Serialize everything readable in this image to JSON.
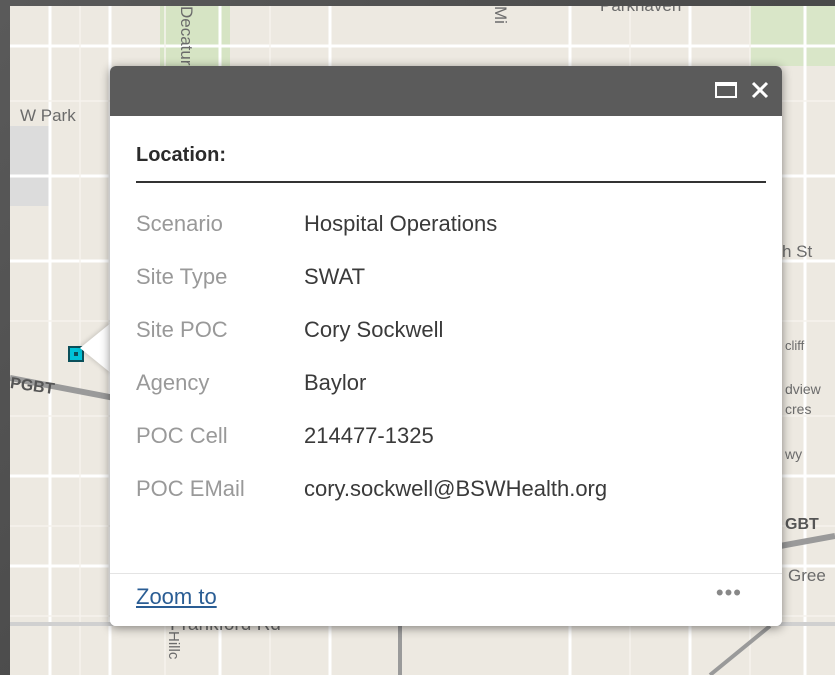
{
  "map": {
    "labels": {
      "top_left_street": "W Park",
      "top_center_partial": "Parkhaven",
      "right_street": "h St",
      "right_partial_1": "cliff",
      "right_partial_2": "dview",
      "right_partial_3": "cres",
      "right_partial_4": "wy",
      "right_road": "GBT",
      "right_partial_5": "Gree",
      "bottom_street": "Frankford Rd",
      "left_road": "PGBT",
      "left_bottom": "Rd",
      "vertical_top": "Decatur",
      "vertical_top2": "Mi",
      "bottom_vertical": "Hillc"
    }
  },
  "marker": {
    "color": "#00c3d8"
  },
  "popup": {
    "title": "Location:",
    "maximize_icon": "maximize-icon",
    "close_icon": "close-icon",
    "attributes": [
      {
        "name": "Scenario",
        "value": "Hospital Operations"
      },
      {
        "name": "Site Type",
        "value": "SWAT"
      },
      {
        "name": "Site POC",
        "value": "Cory Sockwell"
      },
      {
        "name": "Agency",
        "value": "Baylor"
      },
      {
        "name": "POC Cell",
        "value": "214477-1325"
      },
      {
        "name": "POC EMail",
        "value": "cory.sockwell@BSWHealth.org"
      }
    ],
    "footer": {
      "zoom_label": "Zoom to",
      "more_label": "•••"
    }
  },
  "colors": {
    "header": "#5b5b5b",
    "link": "#2a5d94",
    "attr_name": "#999999"
  }
}
